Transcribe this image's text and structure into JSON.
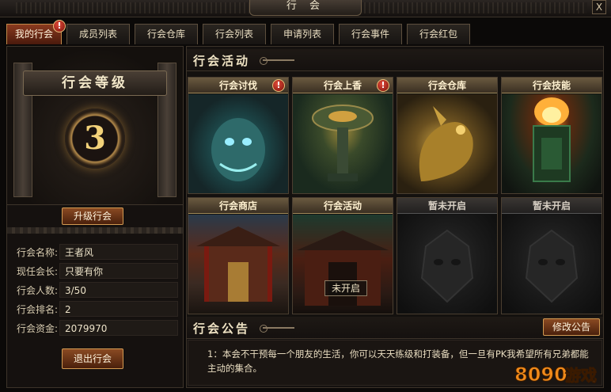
{
  "window": {
    "title": "行 会",
    "close_label": "X"
  },
  "tabs": [
    {
      "label": "我的行会",
      "active": true,
      "alert": "!"
    },
    {
      "label": "成员列表"
    },
    {
      "label": "行会仓库"
    },
    {
      "label": "行会列表"
    },
    {
      "label": "申请列表"
    },
    {
      "label": "行会事件"
    },
    {
      "label": "行会红包"
    }
  ],
  "guild": {
    "level_banner": "行会等级",
    "level": "3",
    "upgrade_label": "升级行会",
    "info": [
      {
        "key": "行会名称:",
        "value": "王者风"
      },
      {
        "key": "现任会长:",
        "value": "只要有你"
      },
      {
        "key": "行会人数:",
        "value": "3/50"
      },
      {
        "key": "行会排名:",
        "value": "2"
      },
      {
        "key": "行会资金:",
        "value": "2079970"
      }
    ],
    "quit_label": "退出行会"
  },
  "activities": {
    "heading": "行会活动",
    "cards": [
      {
        "label": "行会讨伐",
        "alert": "!"
      },
      {
        "label": "行会上香",
        "alert": "!"
      },
      {
        "label": "行会仓库"
      },
      {
        "label": "行会技能"
      },
      {
        "label": "行会商店"
      },
      {
        "label": "行会活动",
        "button": "未开启"
      },
      {
        "label": "暂未开启"
      },
      {
        "label": "暂未开启"
      }
    ]
  },
  "notice": {
    "heading": "行会公告",
    "edit_label": "修改公告",
    "text": "1：本会不干预每一个朋友的生活，你可以天天练级和打装备，但一旦有PK我希望所有兄弟都能主动的集合。"
  },
  "watermark": {
    "text": "8090游戏",
    "color": "#f08a1a"
  },
  "colors": {
    "accent": "#d29a52",
    "alert": "#c8281a",
    "level": "#f3d27a"
  }
}
